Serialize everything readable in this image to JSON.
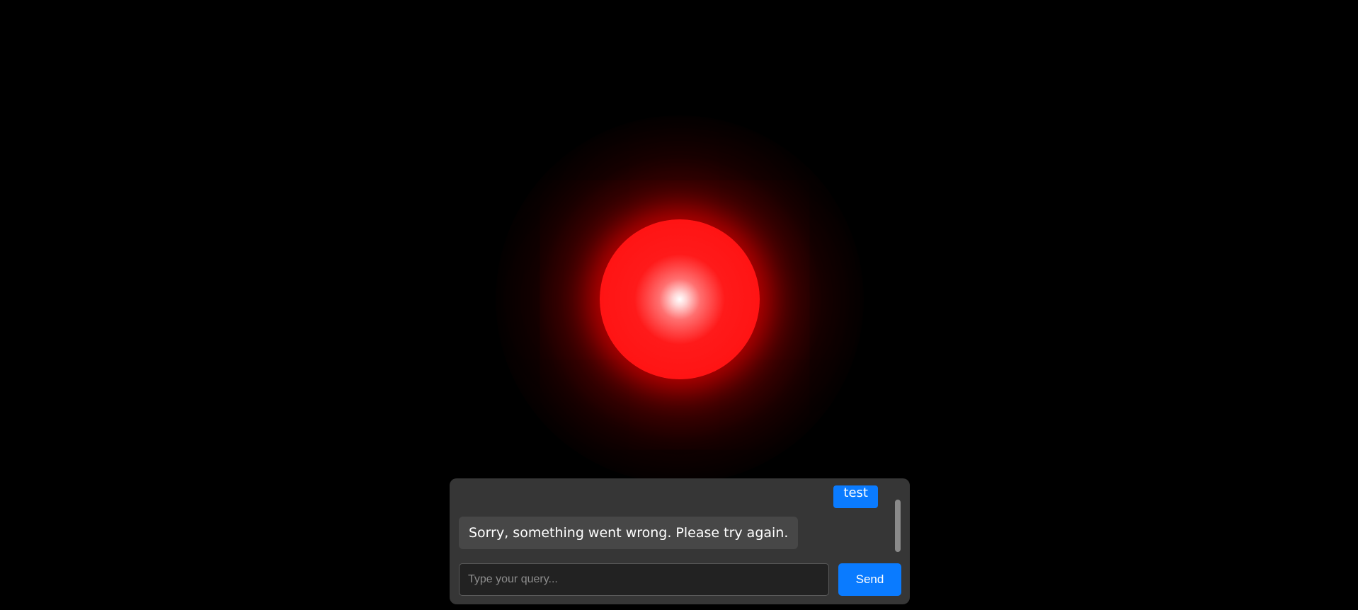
{
  "chat": {
    "messages": [
      {
        "role": "user",
        "text": "test"
      },
      {
        "role": "bot",
        "text": "Sorry, something went wrong. Please try again."
      }
    ],
    "input": {
      "value": "",
      "placeholder": "Type your query..."
    },
    "send_label": "Send"
  },
  "colors": {
    "background": "#000000",
    "orb": "#ff1414",
    "panel": "#363636",
    "accent": "#0a7bff",
    "bot_bubble": "#474747"
  }
}
